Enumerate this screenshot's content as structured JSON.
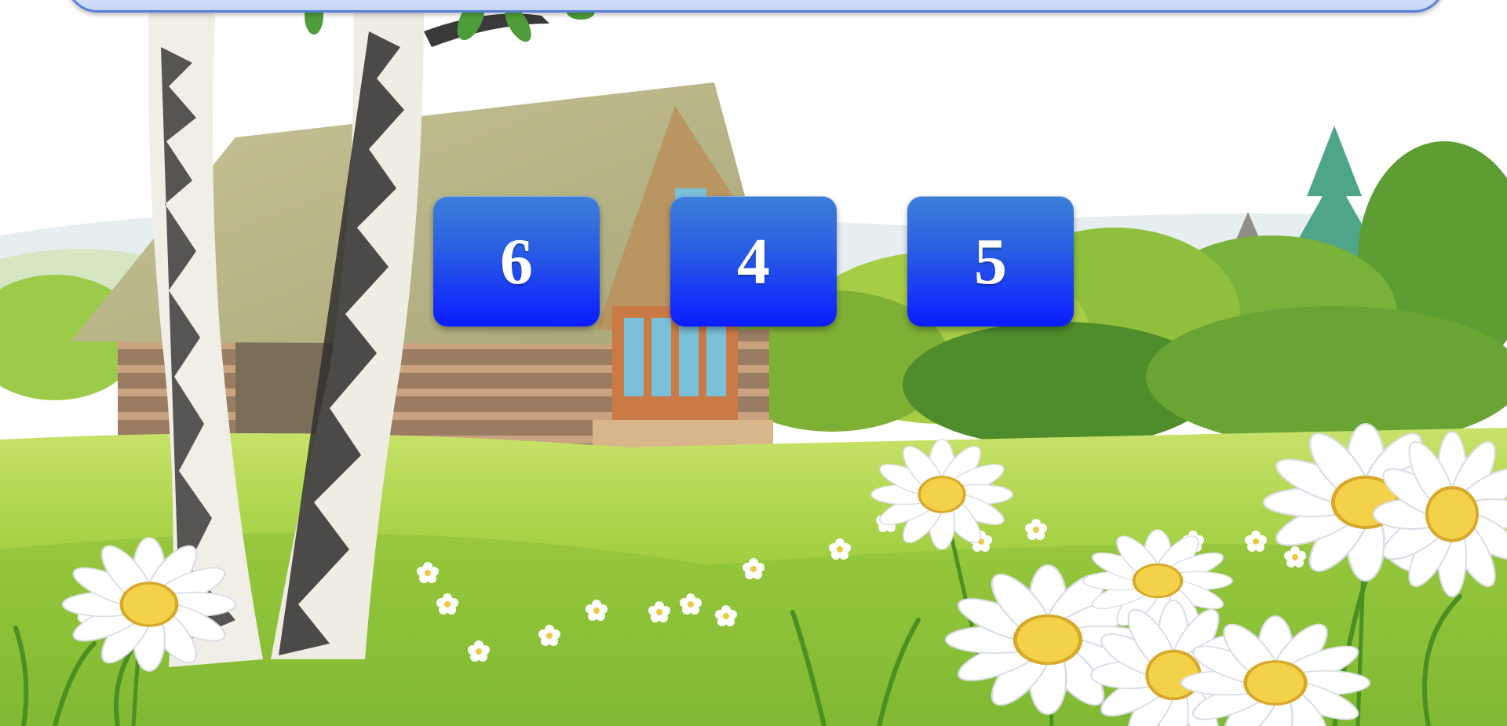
{
  "tiles": [
    {
      "label": "6"
    },
    {
      "label": "4"
    },
    {
      "label": "5"
    }
  ],
  "colors": {
    "tile_top": "#3d7fd8",
    "tile_bottom": "#0a1cff",
    "sky": "#ffffff",
    "grass": "#9fcc3e",
    "panel_border": "#5b7fd6"
  }
}
